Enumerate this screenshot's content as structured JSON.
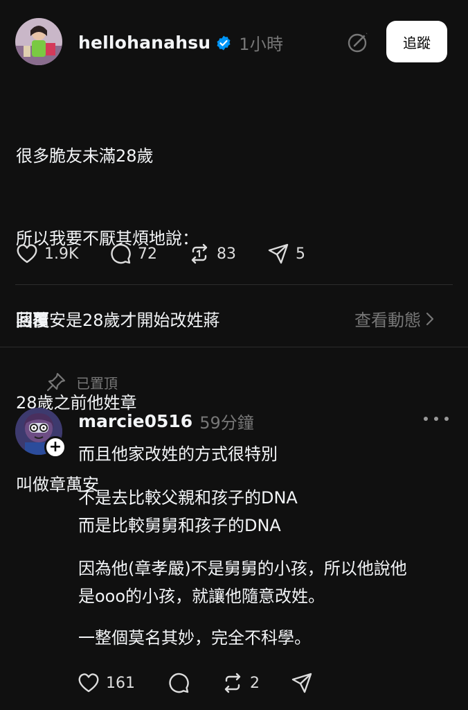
{
  "post": {
    "username": "hellohanahsu",
    "time_ago": "1小時",
    "follow_label": "追蹤",
    "lines": [
      "很多脆友未滿28歲",
      "所以我要不厭其煩地說：",
      "蔣萬安是28歲才開始改姓蔣",
      "28歲之前他姓章",
      "叫做章萬安"
    ],
    "likes": "1.9K",
    "comments": "72",
    "reposts": "83",
    "shares": "5"
  },
  "replies_bar": {
    "label": "回覆",
    "activity_label": "查看動態"
  },
  "comment": {
    "pinned_label": "已置頂",
    "username": "marcie0516",
    "time_ago": "59分鐘",
    "paragraphs": [
      "而且他家改姓的方式很特別",
      "不是去比較父親和孩子的DNA\n而是比較舅舅和孩子的DNA",
      "因為他(章孝嚴)不是舅舅的小孩，所以他說他\n是ooo的小孩，就讓他隨意改姓。",
      "一整個莫名其妙，完全不科學。"
    ],
    "likes": "161",
    "reposts": "2"
  },
  "colors": {
    "background": "#101010",
    "text": "#f3f5f7",
    "muted": "#777777",
    "verified": "#0095f6"
  },
  "icons": [
    "verified-badge-icon",
    "edit-icon",
    "heart-icon",
    "comment-icon",
    "repost-icon",
    "share-icon",
    "chevron-right-icon",
    "pin-icon",
    "plus-icon",
    "more-icon"
  ]
}
